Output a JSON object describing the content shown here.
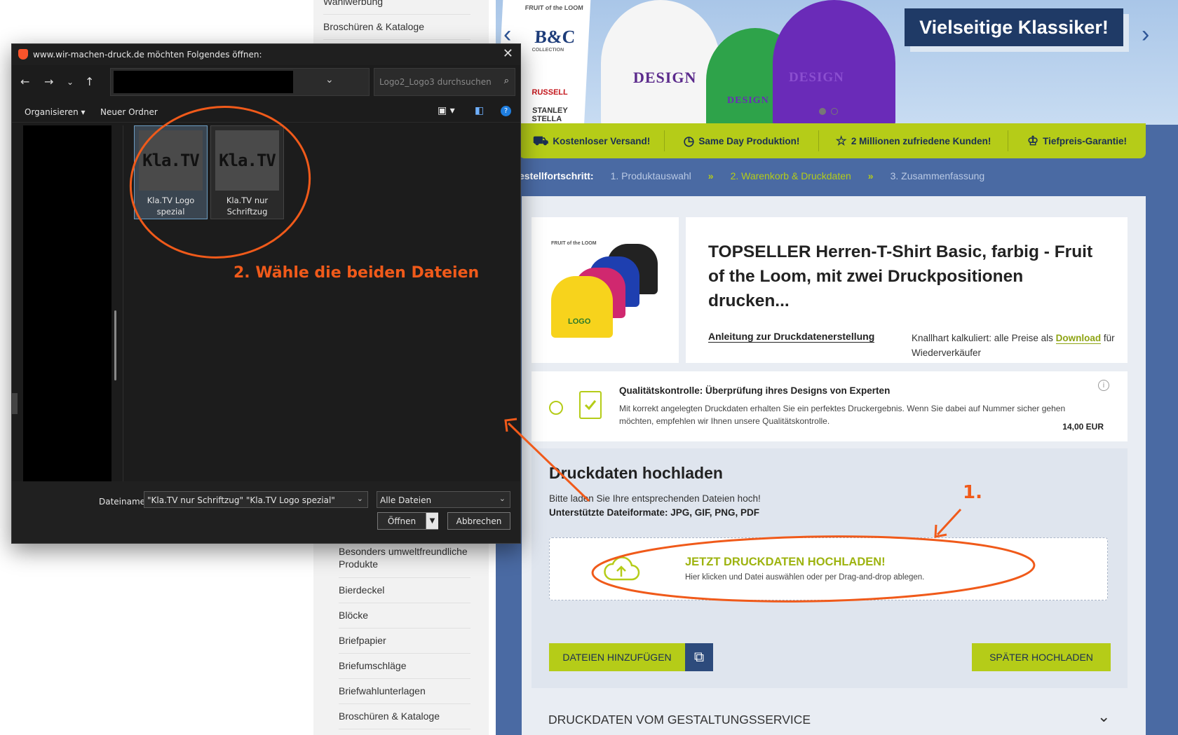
{
  "sidebar": {
    "categories_top": [
      "Wahlwerbung",
      "Broschüren & Kataloge"
    ],
    "categories_bottom": [
      "Besonders umweltfreundliche Produkte",
      "Bierdeckel",
      "Blöcke",
      "Briefpapier",
      "Briefumschläge",
      "Briefwahlunterlagen",
      "Broschüren & Kataloge"
    ]
  },
  "hero": {
    "title": "Vielseitige Klassiker!",
    "brands": [
      "FRUIT of the LOOM",
      "B&C",
      "COLLECTION",
      "RUSSELL",
      "STANLEY STELLA"
    ],
    "shirt_print": "DESIGN"
  },
  "usp": [
    {
      "icon": "truck-icon",
      "label": "Kostenloser Versand!"
    },
    {
      "icon": "clock-icon",
      "label": "Same Day Produktion!"
    },
    {
      "icon": "star-icon",
      "label": "2 Millionen zufriedene Kunden!"
    },
    {
      "icon": "award-icon",
      "label": "Tiefpreis-Garantie!"
    }
  ],
  "progress": {
    "label": "estellfortschritt:",
    "steps": [
      "1. Produktauswahl",
      "2. Warenkorb & Druckdaten",
      "3. Zusammenfassung"
    ],
    "separator": "»"
  },
  "product": {
    "title": "TOPSELLER Herren-T-Shirt Basic, farbig - Fruit of the Loom, mit zwei Druckpositionen drucken...",
    "guide_link": "Anleitung zur Druckdatenerstellung",
    "price_note_prefix": "Knallhart kalkuliert: alle Preise als ",
    "price_note_link": "Download",
    "price_note_suffix": " für Wiederverkäufer",
    "image_brand": "FRUIT of the LOOM",
    "image_logo": "LOGO"
  },
  "quality_check": {
    "title": "Qualitätskontrolle: Überprüfung ihres Designs von Experten",
    "text": "Mit korrekt angelegten Druckdaten erhalten Sie ein perfektes Druckergebnis. Wenn Sie dabei auf Nummer sicher gehen möchten, empfehlen wir Ihnen unsere Qualitätskontrolle.",
    "price": "14,00 EUR",
    "info": "i"
  },
  "upload": {
    "title": "Druckdaten hochladen",
    "subtitle": "Bitte laden Sie Ihre entsprechenden Dateien hoch!",
    "formats": "Unterstützte Dateiformate: JPG, GIF, PNG, PDF",
    "drop_title": "JETZT DRUCKDATEN HOCHLADEN!",
    "drop_sub": "Hier klicken und Datei auswählen oder per Drag-and-drop ablegen.",
    "add_files": "DATEIEN HINZUFÜGEN",
    "later": "SPÄTER HOCHLADEN",
    "design_service": "DRUCKDATEN VOM GESTALTUNGSSERVICE"
  },
  "dialog": {
    "title": "www.wir-machen-druck.de möchten Folgendes öffnen:",
    "search_placeholder": "Logo2_Logo3 durchsuchen",
    "organize": "Organisieren",
    "new_folder": "Neuer Ordner",
    "files": [
      {
        "name": "Kla.TV Logo spezial",
        "thumb_text": "Kla.TV",
        "selected": true
      },
      {
        "name": "Kla.TV nur Schriftzug",
        "thumb_text": "Kla.TV",
        "selected": false
      }
    ],
    "filename_label": "Dateiname:",
    "filename_value": "\"Kla.TV nur Schriftzug\" \"Kla.TV Logo spezial\"",
    "filetype": "Alle Dateien",
    "open": "Öffnen",
    "cancel": "Abbrechen"
  },
  "annotations": {
    "step1": "1.",
    "step2": "2. Wähle die beiden Dateien",
    "color": "#f05a1a"
  }
}
